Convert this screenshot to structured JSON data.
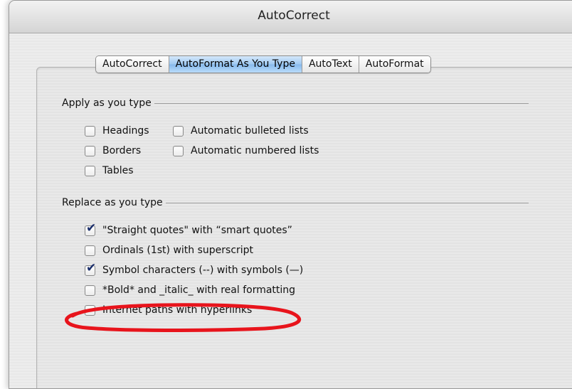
{
  "window": {
    "title": "AutoCorrect"
  },
  "tabs": [
    {
      "label": "AutoCorrect",
      "active": false
    },
    {
      "label": "AutoFormat As You Type",
      "active": true
    },
    {
      "label": "AutoText",
      "active": false
    },
    {
      "label": "AutoFormat",
      "active": false
    }
  ],
  "apply_section": {
    "title": "Apply as you type",
    "options": [
      {
        "label": "Headings",
        "checked": false
      },
      {
        "label": "Borders",
        "checked": false
      },
      {
        "label": "Tables",
        "checked": false
      },
      {
        "label": "Automatic bulleted lists",
        "checked": false
      },
      {
        "label": "Automatic numbered lists",
        "checked": false
      }
    ]
  },
  "replace_section": {
    "title": "Replace as you type",
    "options": [
      {
        "label": "\"Straight quotes\" with “smart quotes”",
        "checked": true
      },
      {
        "label": "Ordinals (1st) with superscript",
        "checked": false
      },
      {
        "label": "Symbol characters (--) with symbols (—)",
        "checked": true
      },
      {
        "label": "*Bold* and _italic_ with real formatting",
        "checked": false
      },
      {
        "label": "Internet paths with hyperlinks",
        "checked": false
      }
    ]
  },
  "annotation": {
    "color": "#e8141c"
  },
  "colors": {
    "tab_active": "#9ec8f0",
    "check": "#1a2e6b"
  }
}
